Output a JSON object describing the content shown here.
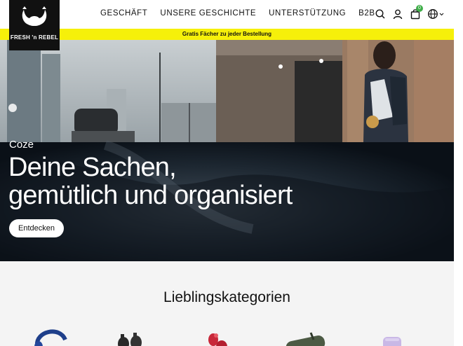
{
  "brand": {
    "logo_text": "FRESH 'n REBEL"
  },
  "nav": {
    "items": [
      "GESCHÄFT",
      "UNSERE GESCHICHTE",
      "UNTERSTÜTZUNG",
      "B2B"
    ]
  },
  "header_icons": {
    "cart_count": "0",
    "icons": [
      "search-icon",
      "account-icon",
      "cart-icon",
      "globe-icon",
      "chevron-down-icon"
    ]
  },
  "announcement": {
    "text": "Gratis Fächer zu jeder Bestellung"
  },
  "hero": {
    "subtitle": "Coze",
    "title_line1": "Deine Sachen,",
    "title_line2": "gemütlich und organisiert",
    "cta_label": "Entdecken"
  },
  "categories": {
    "title": "Lieblingskategorien",
    "items": [
      "headphones",
      "earbuds",
      "earbuds-red",
      "speaker",
      "powerbank"
    ]
  },
  "colors": {
    "announcement_bg": "#f6f00a",
    "badge": "#3fae49",
    "logo_bg": "#111111"
  }
}
